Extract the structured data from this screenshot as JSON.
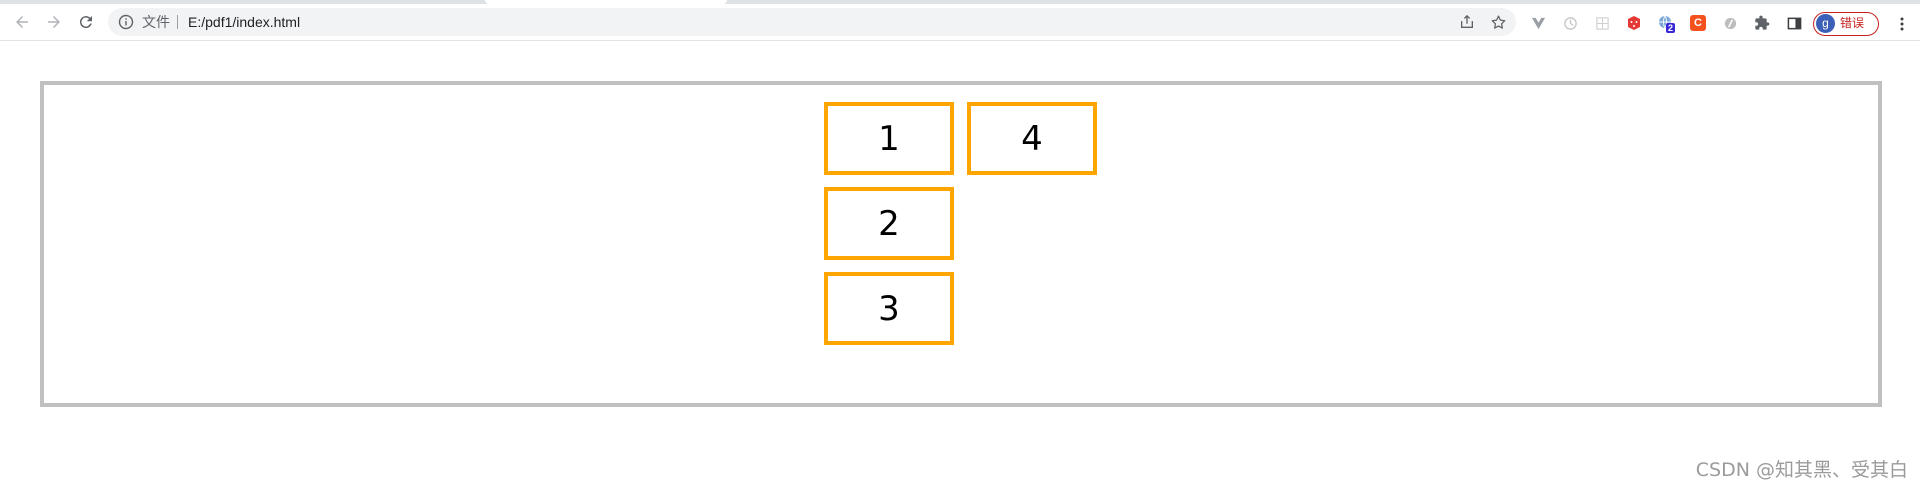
{
  "browser": {
    "scheme_label": "文件",
    "url": "E:/pdf1/index.html",
    "profile": {
      "avatar_letter": "g",
      "status_label": "错误",
      "status_color": "#c5221f"
    },
    "extensions": [
      {
        "name": "vue-devtools-icon"
      },
      {
        "name": "timer-extension-icon"
      },
      {
        "name": "grid-extension-icon"
      },
      {
        "name": "dice-extension-icon"
      },
      {
        "name": "translate-extension-icon",
        "badge": "2"
      },
      {
        "name": "c-extension-icon",
        "label": "C"
      },
      {
        "name": "circle-extension-icon"
      },
      {
        "name": "puzzle-icon"
      },
      {
        "name": "side-panel-icon"
      }
    ]
  },
  "page": {
    "box_border_color": "#c0c0c0",
    "cell_border_color": "#ffa500",
    "cells": [
      {
        "label": "1"
      },
      {
        "label": "2"
      },
      {
        "label": "3"
      },
      {
        "label": "4"
      }
    ]
  },
  "watermark": "CSDN @知其黑、受其白"
}
